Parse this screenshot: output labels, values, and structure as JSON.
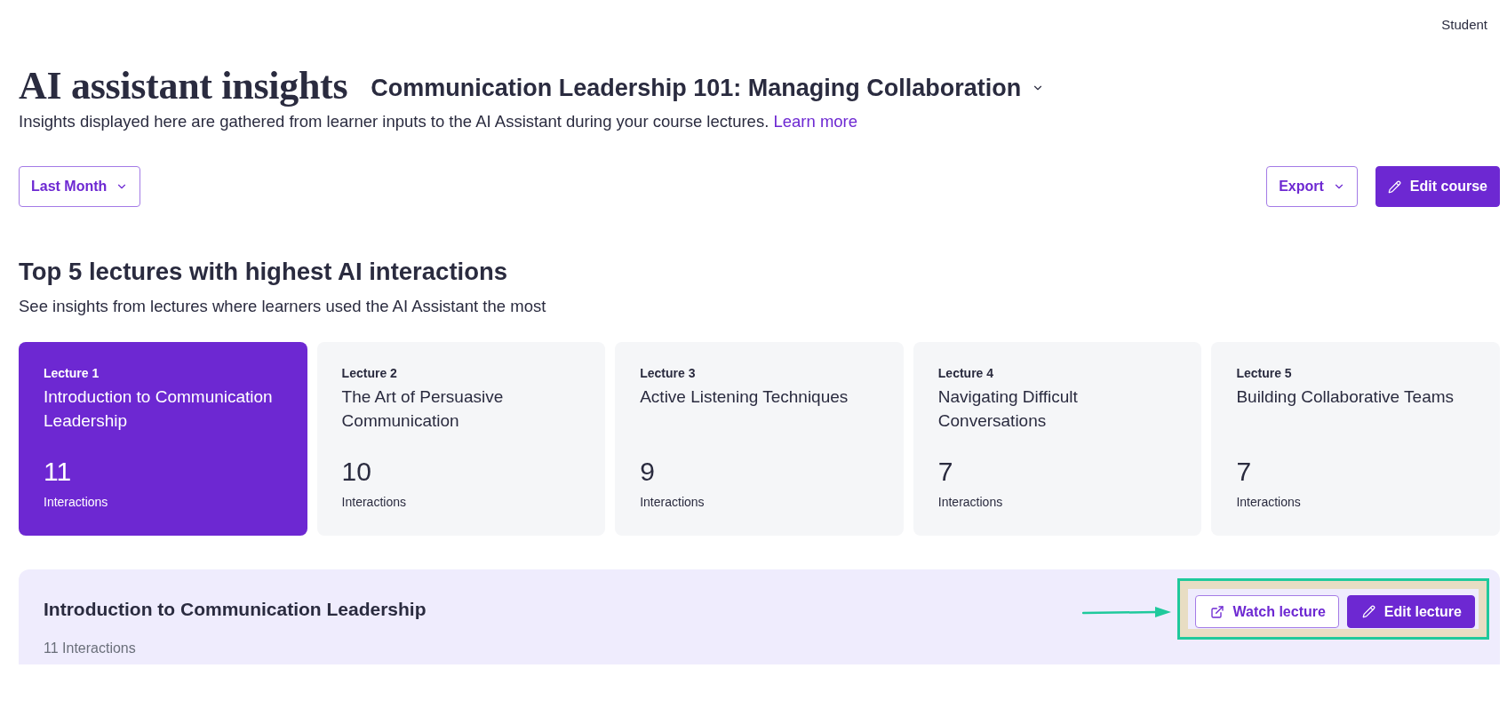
{
  "header": {
    "user_label": "Student"
  },
  "page": {
    "title": "AI assistant insights",
    "course_selector": {
      "label": "Communication Leadership 101: Managing Collaboration"
    },
    "description": "Insights displayed here are gathered from learner inputs to the AI Assistant during your course lectures.",
    "learn_more_link": "Learn more"
  },
  "toolbar": {
    "date_filter": {
      "label": "Last Month"
    },
    "actions": [
      {
        "label": "Export",
        "kind": "dropdown"
      },
      {
        "label": "Edit course",
        "kind": "edit"
      }
    ]
  },
  "top_lectures": {
    "title": "Top 5 lectures with highest AI interactions",
    "subtitle": "See insights from lectures where learners used the AI Assistant the most",
    "cards": [
      {
        "number_label": "Lecture 1",
        "title": "Introduction to Communication Leadership",
        "count": "11",
        "count_label": "Interactions",
        "selected": true
      },
      {
        "number_label": "Lecture 2",
        "title": "The Art of Persuasive Communication",
        "count": "10",
        "count_label": "Interactions",
        "selected": false
      },
      {
        "number_label": "Lecture 3",
        "title": "Active Listening Techniques",
        "count": "9",
        "count_label": "Interactions",
        "selected": false
      },
      {
        "number_label": "Lecture 4",
        "title": "Navigating Difficult Conversations",
        "count": "7",
        "count_label": "Interactions",
        "selected": false
      },
      {
        "number_label": "Lecture 5",
        "title": "Building Collaborative Teams",
        "count": "7",
        "count_label": "Interactions",
        "selected": false
      }
    ]
  },
  "lecture_detail": {
    "title": "Introduction to Communication Leadership",
    "interactions": "11 Interactions",
    "actions_highlighted": true,
    "buttons": [
      {
        "label": "Watch lecture",
        "kind": "open"
      },
      {
        "label": "Edit lecture",
        "kind": "edit"
      }
    ]
  }
}
